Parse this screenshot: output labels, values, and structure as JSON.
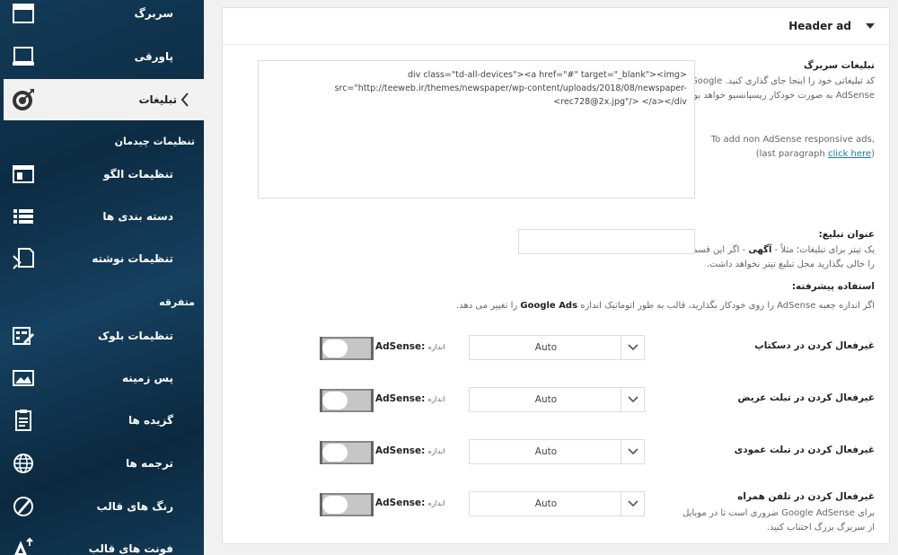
{
  "sidebar": {
    "items": [
      {
        "label": "سربرگ",
        "icon": "header-icon"
      },
      {
        "label": "پاورقی",
        "icon": "footer-icon"
      },
      {
        "label": "تبلیغات",
        "icon": "target-icon",
        "active": true
      },
      {
        "label": "تنظیمات الگو",
        "icon": "template-icon"
      },
      {
        "label": "دسته بندی ها",
        "icon": "list-icon"
      },
      {
        "label": "تنظیمات نوشته",
        "icon": "post-icon"
      },
      {
        "label": "تنظیمات بلوک",
        "icon": "block-icon"
      },
      {
        "label": "پس زمینه",
        "icon": "image-icon"
      },
      {
        "label": "گزیده ها",
        "icon": "clipboard-icon"
      },
      {
        "label": "ترجمه ها",
        "icon": "globe-icon"
      },
      {
        "label": "رنگ های قالب",
        "icon": "brush-icon"
      },
      {
        "label": "فونت های قالب",
        "icon": "font-icon"
      }
    ],
    "sections": {
      "layout": "تنظیمات چیدمان",
      "misc": "متفرقه"
    }
  },
  "panel": {
    "title": "Header ad",
    "ad_code_label": "تبلیغات سربرگ",
    "ad_code_desc": "کد تبلیغاتی خود را اینجا جای گذاری کنید. Google AdSense به صورت خودکار ریسپانسیو خواهد بود.",
    "non_adsense_text": "To add non AdSense responsive ads,",
    "click_here": "click here",
    "last_paragraph": "(last paragraph",
    "code_value": "div class=\"td-all-devices\"><a href=\"#\" target=\"_blank\"><img> src=\"http://teeweb.ir/themes/newspaper/wp-content/uploads/2018/08/newspaper-rec728@2x.jpg\"/> </a></div>",
    "ad_title_label": "عنوان تبلیغ:",
    "ad_title_desc_1": "یک تیتر برای تبلیغات؛ مثلاً -",
    "ad_title_desc_bold": "آگهی",
    "ad_title_desc_2": "- اگر این قسمت را خالی بگذارید محل تبلیغ تیتر نخواهد داشت.",
    "advanced_label": "استفاده پیشرفته:",
    "advanced_desc_1": "اگر اندازه جعبه AdSense را روی خودکار بگذارید، قالب به طور اتوماتیک اندازه",
    "advanced_desc_bold": "Google Ads",
    "advanced_desc_2": "را تغییر می دهد.",
    "adsense_size_small": "اندازه",
    "adsense_word": "AdSense:",
    "rows": [
      {
        "label": "غیرفعال کردن در دسکتاپ",
        "value": "Auto"
      },
      {
        "label": "غیرفعال کردن در تبلت عریض",
        "value": "Auto"
      },
      {
        "label": "غیرفعال کردن در تبلت عمودی",
        "value": "Auto"
      },
      {
        "label": "غیرفعال کردن در تلفن همراه",
        "value": "Auto",
        "desc": "برای Google AdSense ضروری است تا در موبایل از سربرگ بزرگ اجتناب کنید."
      }
    ]
  }
}
